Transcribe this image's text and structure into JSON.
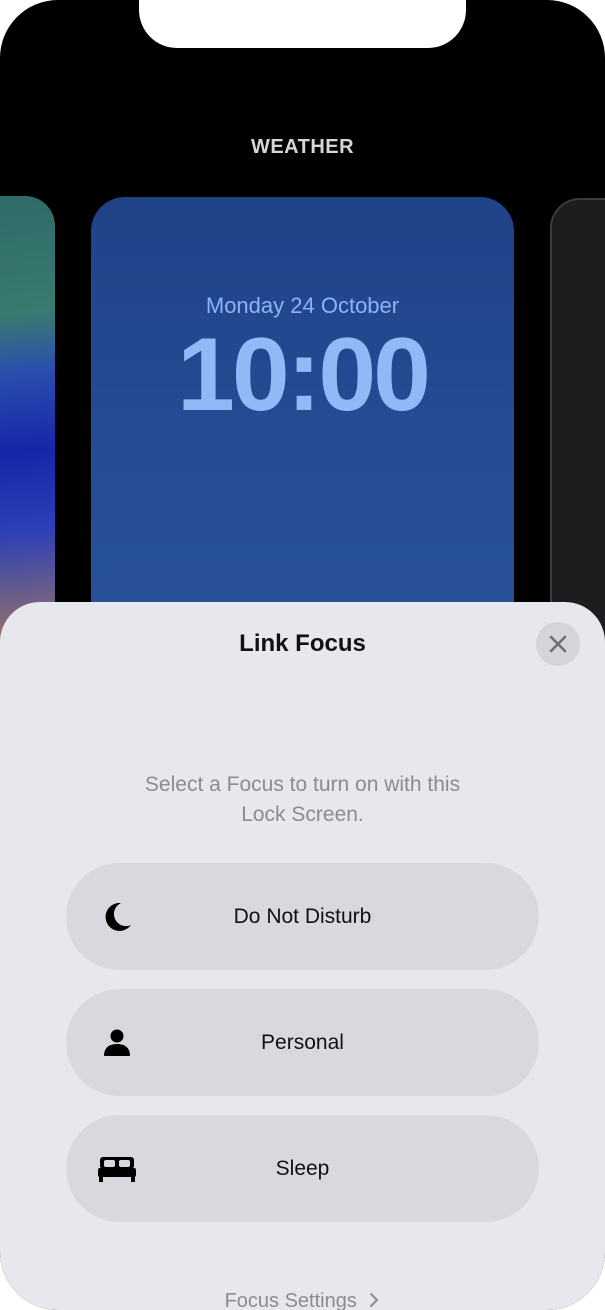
{
  "gallery": {
    "label": "WEATHER"
  },
  "lock_screen": {
    "date": "Monday 24 October",
    "time": "10:00"
  },
  "sheet": {
    "title": "Link Focus",
    "close_icon": "close-icon",
    "subtitle": "Select a Focus to turn on with this Lock Screen.",
    "options": [
      {
        "label": "Do Not Disturb",
        "icon": "moon-icon"
      },
      {
        "label": "Personal",
        "icon": "person-icon"
      },
      {
        "label": "Sleep",
        "icon": "bed-icon"
      }
    ],
    "footer_link": "Focus Settings",
    "footer_chevron": "chevron-right-icon"
  },
  "colors": {
    "background": "#000000",
    "sheet": "#e6e8ed",
    "option": "#d7d9de",
    "clock": "#91b9f7"
  }
}
